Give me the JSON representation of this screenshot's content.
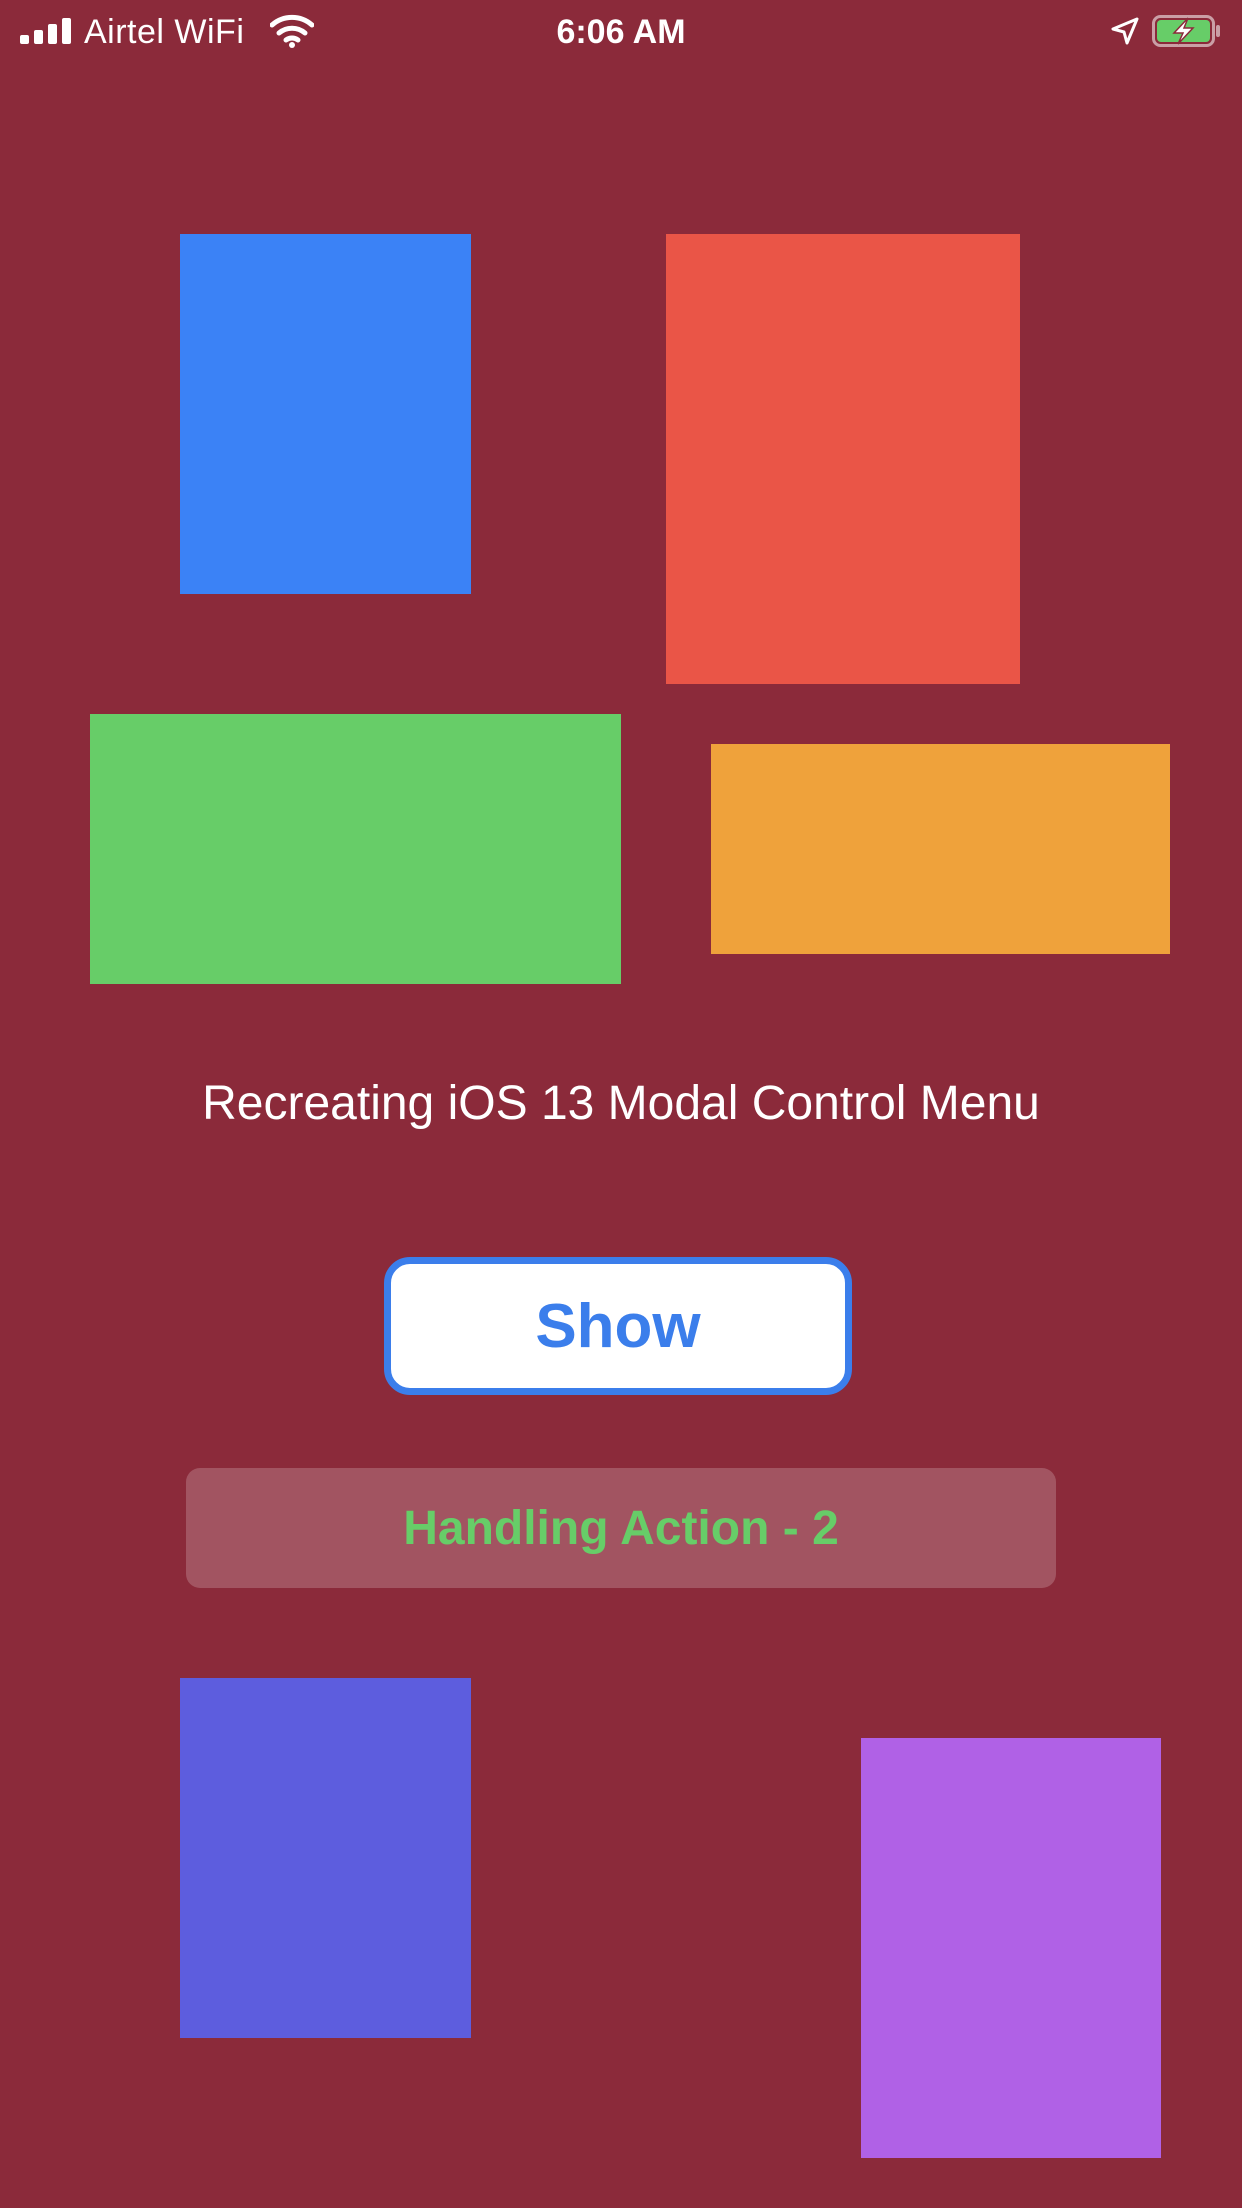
{
  "colors": {
    "background": "#8B2A3A",
    "blue": "#3B82F6",
    "red": "#EA5547",
    "green": "#67CD68",
    "orange": "#EFA23B",
    "indigo": "#5D5DDE",
    "purple": "#B061E6",
    "button_accent": "#3B7EEB",
    "action_text": "#67CD68",
    "battery_fill": "#67CD68"
  },
  "status_bar": {
    "carrier": "Airtel WiFi",
    "time": "6:06 AM",
    "icons": [
      "signal-bars-icon",
      "wifi-icon",
      "location-arrow-icon",
      "battery-charging-icon"
    ]
  },
  "main": {
    "title": "Recreating iOS 13 Modal Control Menu",
    "show_button_label": "Show",
    "action_label": "Handling Action - 2"
  }
}
